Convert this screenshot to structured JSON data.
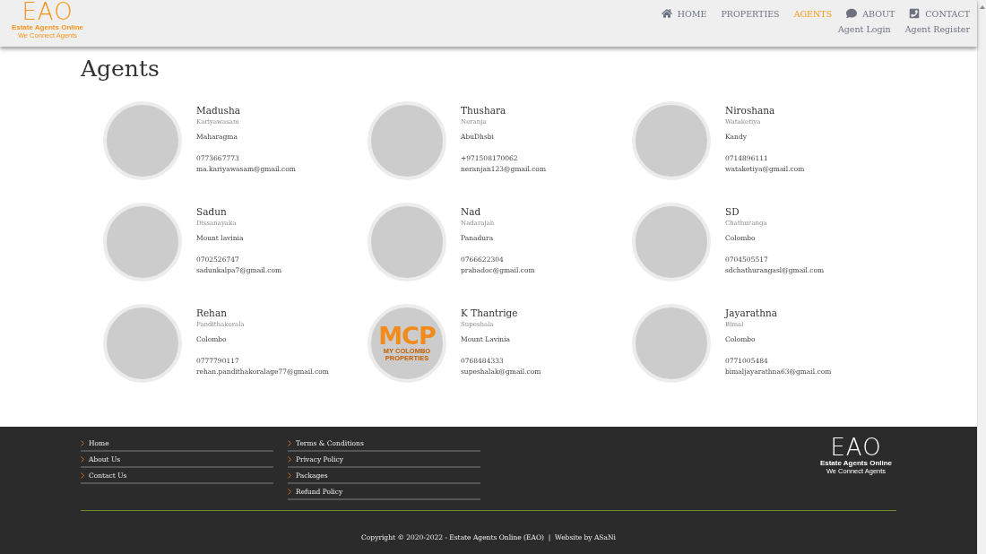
{
  "logo": {
    "letters": "EAO",
    "name": "Estate Agents Online",
    "tagline": "We Connect Agents"
  },
  "nav": [
    {
      "label": "HOME",
      "selected": false
    },
    {
      "label": "PROPERTIES",
      "selected": false
    },
    {
      "label": "AGENTS",
      "selected": true
    },
    {
      "label": "ABOUT",
      "selected": false
    },
    {
      "label": "CONTACT",
      "selected": false
    }
  ],
  "account_links": [
    "Agent Login",
    "Agent Register"
  ],
  "title": "Agents",
  "agents": [
    {
      "name": "Madusha",
      "surname": "Kariyawasam",
      "city": "Maharagma",
      "phone": "0773667773",
      "email": "ma.kariyawasam@gmail.com"
    },
    {
      "name": "Thushara",
      "surname": "Neranja",
      "city": "AbuDhsbi",
      "phone": "+971508170062",
      "email": "neranjan123@gmail.com"
    },
    {
      "name": "Niroshana",
      "surname": "Wataketiya",
      "city": "Kandy",
      "phone": "0714896111",
      "email": "wataketiya@gmail.com"
    },
    {
      "name": "Sadun",
      "surname": "Dissanayaka",
      "city": "Mount lavinia",
      "phone": "0702526747",
      "email": "sadunkalpa7@gmail.com"
    },
    {
      "name": "Nad",
      "surname": "Nadarajah",
      "city": "Panadura",
      "phone": "0766622304",
      "email": "prabadoc@gmail.com"
    },
    {
      "name": "SD",
      "surname": "Chathuranga",
      "city": "Colombo",
      "phone": "0704505517",
      "email": "sdchathurangasl@gmail.com"
    },
    {
      "name": "Rehan",
      "surname": "Pandithakorala",
      "city": "Colombo",
      "phone": "0777790117",
      "email": "rehan.pandithakoralage77@gmail.com"
    },
    {
      "name": "K Thantrige",
      "surname": "Supeshala",
      "city": "Mount Lavinia",
      "phone": "0768484333",
      "email": "supeshalak@gmail.com",
      "avatar": {
        "kind": "logo",
        "text": "MCP",
        "caption": "MY COLOMBO PROPERTIES"
      }
    },
    {
      "name": "Jayarathna",
      "surname": "Bimal",
      "city": "Colombo",
      "phone": "0771005484",
      "email": "bimaljayarathna63@gmail.com"
    }
  ],
  "footer": {
    "link_columns": [
      [
        "Home",
        "About Us",
        "Contact Us"
      ],
      [
        "Terms & Conditions",
        "Privacy Policy",
        "Packages",
        "Refund Policy"
      ]
    ],
    "logo": {
      "letters": "EAO",
      "name": "Estate Agents Online",
      "tagline": "We Connect Agents"
    },
    "copyright": "Copyright © 2020-2022 - Estate Agents Online (EAO)  |  Website by ASaNi"
  }
}
